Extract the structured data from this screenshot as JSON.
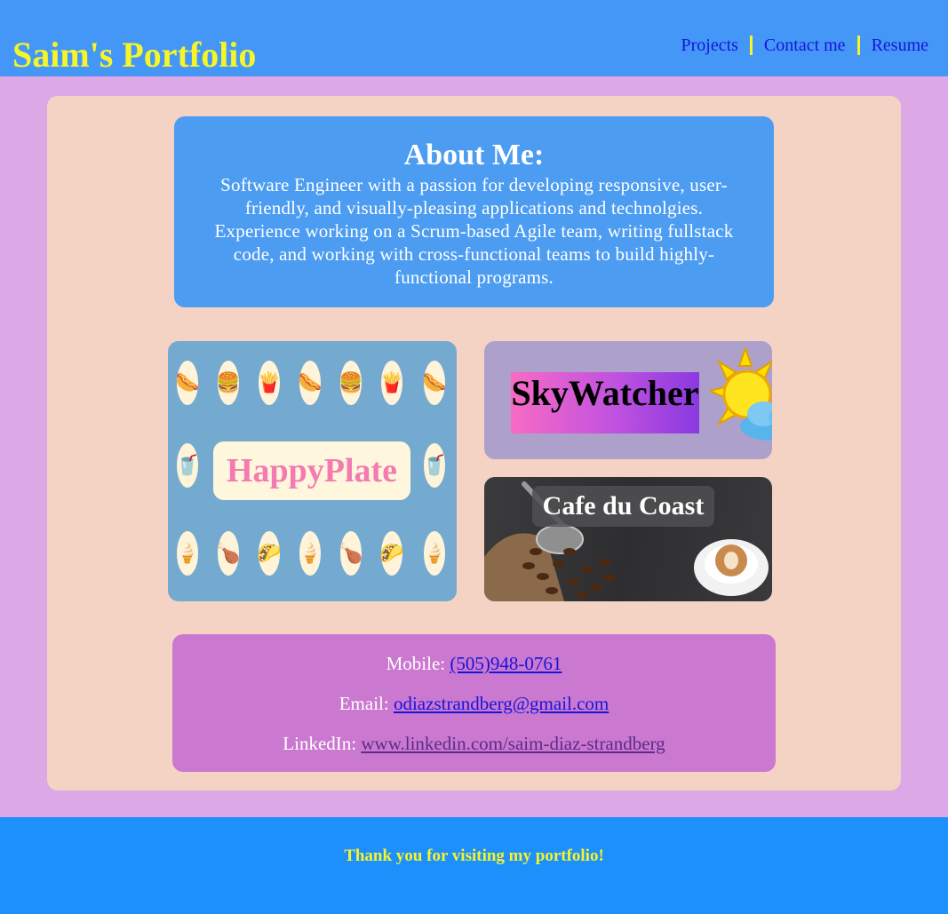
{
  "header": {
    "title": "Saim's Portfolio",
    "nav": [
      "Projects",
      "Contact me",
      "Resume"
    ]
  },
  "about": {
    "heading": "About Me:",
    "text": "Software Engineer with a passion for developing responsive, user-friendly, and visually-pleasing applications and technolgies. Experience working on a Scrum-based Agile team, writing fullstack code, and working with cross-functional teams to build highly-functional programs."
  },
  "projects": [
    {
      "label": "HappyPlate"
    },
    {
      "label": "SkyWatcher"
    },
    {
      "label": "Cafe du Coast"
    }
  ],
  "contact": {
    "mobile_label": "Mobile:",
    "mobile": "(505)948-0761",
    "email_label": "Email:",
    "email": "odiazstrandberg@gmail.com",
    "linkedin_label": "LinkedIn:",
    "linkedin": "www.linkedin.com/saim-diaz-strandberg"
  },
  "footer": {
    "text": "Thank you for visiting my portfolio!"
  },
  "colors": {
    "header_bg": "#4597f7",
    "title_yellow": "#f6f52a",
    "page_bg": "#dca8e6",
    "card_bg": "#f4d3c5",
    "about_bg": "#4c9cf2",
    "contact_bg": "#cb78d0",
    "footer_bg": "#1e90fb",
    "link_blue": "#1515d8"
  },
  "icons": [
    "hotdog-icon",
    "burger-icon",
    "fries-icon",
    "drink-icon",
    "icecream-icon",
    "chicken-icon",
    "taco-icon",
    "sun-cloud-icon",
    "coffee-cup-icon"
  ]
}
